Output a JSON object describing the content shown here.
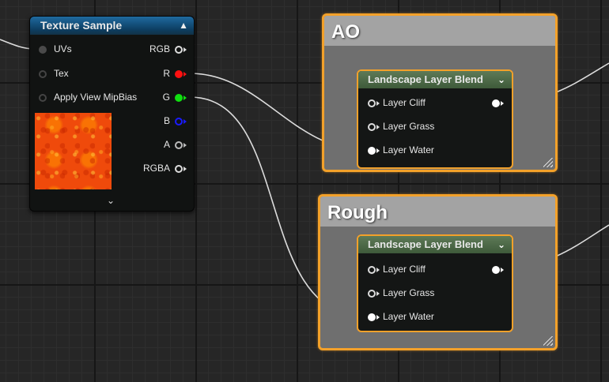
{
  "texture_sample": {
    "title": "Texture Sample",
    "inputs": [
      "UVs",
      "Tex",
      "Apply View MipBias"
    ],
    "outputs": [
      {
        "label": "RGB",
        "color": "#ffffff"
      },
      {
        "label": "R",
        "color": "#ff0000"
      },
      {
        "label": "G",
        "color": "#00e000"
      },
      {
        "label": "B",
        "color": "#1010ff"
      },
      {
        "label": "A",
        "color": "#bbbbbb"
      },
      {
        "label": "RGBA",
        "color": "#ffffff"
      }
    ]
  },
  "comments": [
    {
      "title": "AO",
      "node_title": "Landscape Layer Blend",
      "layers": [
        "Layer Cliff",
        "Layer Grass",
        "Layer Water"
      ]
    },
    {
      "title": "Rough",
      "node_title": "Landscape Layer Blend",
      "layers": [
        "Layer Cliff",
        "Layer Grass",
        "Layer Water"
      ]
    }
  ],
  "colors": {
    "comment_border": "#f3a12a",
    "header_blue": "#1f6aa0",
    "header_green": "#5e7a57"
  }
}
